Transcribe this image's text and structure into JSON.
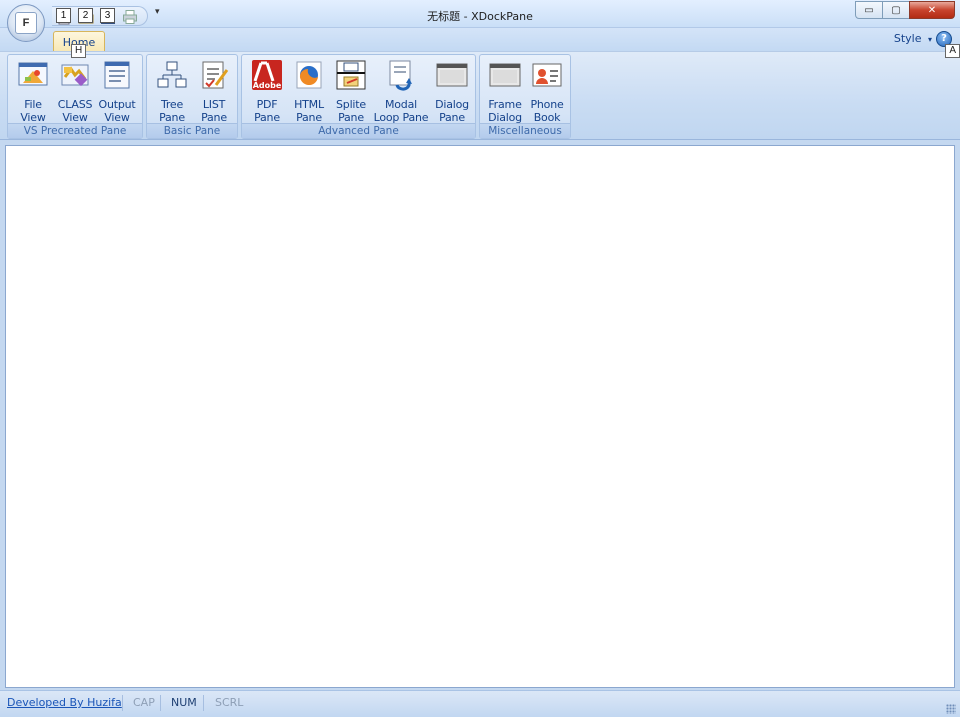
{
  "window": {
    "title": "无标题 - XDockPane",
    "minimize_glyph": "▭",
    "maximize_glyph": "▢",
    "close_glyph": "✕"
  },
  "app_button": {
    "keytip": "F"
  },
  "quick_access": {
    "keytips": [
      "1",
      "2",
      "3"
    ],
    "buttons": [
      "new-icon",
      "open-icon",
      "save-icon",
      "print-icon"
    ],
    "dropdown_glyph": "▾"
  },
  "tabs": [
    {
      "label": "Home",
      "keytip": "H",
      "selected": true
    }
  ],
  "style_menu": {
    "label": "Style",
    "arrow": "▾"
  },
  "help": {
    "glyph": "?",
    "keytip": "A"
  },
  "ribbon": {
    "groups": [
      {
        "label": "VS Precreated Pane",
        "buttons": [
          {
            "label": "File\nView",
            "icon": "file-view-icon"
          },
          {
            "label": "CLASS\nView",
            "icon": "class-view-icon"
          },
          {
            "label": "Output\nView",
            "icon": "output-view-icon"
          }
        ]
      },
      {
        "label": "Basic Pane",
        "buttons": [
          {
            "label": "Tree\nPane",
            "icon": "tree-pane-icon"
          },
          {
            "label": "LIST\nPane",
            "icon": "list-pane-icon"
          }
        ]
      },
      {
        "label": "Advanced Pane",
        "buttons": [
          {
            "label": "PDF\nPane",
            "icon": "adobe-pdf-icon",
            "icon_text": "Adobe"
          },
          {
            "label": "HTML\nPane",
            "icon": "firefox-icon"
          },
          {
            "label": "Splite\nPane",
            "icon": "split-pane-icon"
          },
          {
            "label": "Modal\nLoop Pane",
            "icon": "modal-loop-icon"
          },
          {
            "label": "Dialog\nPane",
            "icon": "dialog-pane-icon"
          }
        ]
      },
      {
        "label": "Miscellaneous",
        "buttons": [
          {
            "label": "Frame\nDialog",
            "icon": "frame-dialog-icon"
          },
          {
            "label": "Phone\nBook",
            "icon": "phone-book-icon"
          }
        ]
      }
    ]
  },
  "status": {
    "link": "Developed By Huzifa",
    "indicators": [
      {
        "label": "CAP",
        "active": false
      },
      {
        "label": "NUM",
        "active": true
      },
      {
        "label": "SCRL",
        "active": false
      }
    ]
  },
  "colors": {
    "accent": "#15428b",
    "ribbon_bg": "#c9dcf3",
    "selected_tab": "#f7e7b3",
    "close_button": "#c8442e"
  }
}
